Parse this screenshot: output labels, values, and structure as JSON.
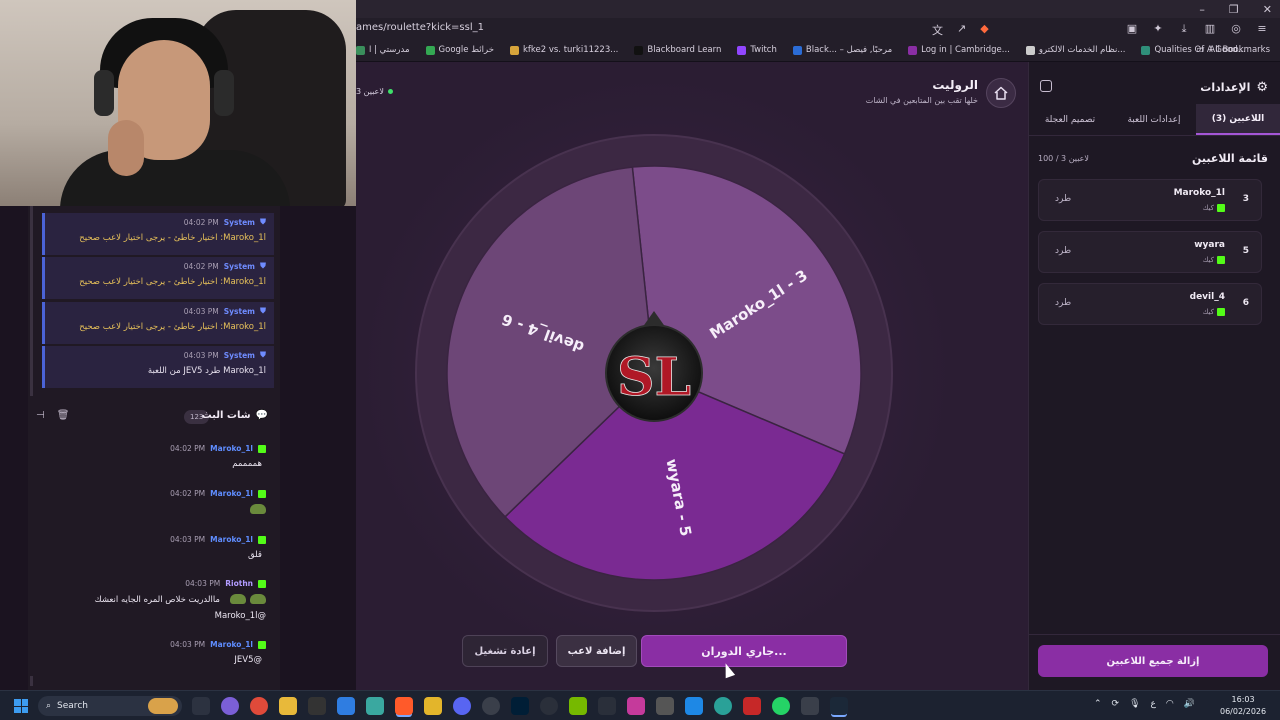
{
  "browser": {
    "url": "ames/roulette?kick=ssl_1",
    "bookmarks": [
      {
        "label": "مدرستي | ا",
        "color": "#3a8f5c"
      },
      {
        "label": "Google خرائط",
        "color": "#34a853"
      },
      {
        "label": "kfke2 vs. turki11223...",
        "color": "#d7a43b"
      },
      {
        "label": "Blackboard Learn",
        "color": "#111111"
      },
      {
        "label": "Twitch",
        "color": "#9146ff"
      },
      {
        "label": "Black... – مرحبًا, فيصل",
        "color": "#2b6cd6"
      },
      {
        "label": "Log in | Cambridge...",
        "color": "#8a2ea4"
      },
      {
        "label": "نظام الخدمات الالكترو...",
        "color": "#cccccc"
      },
      {
        "label": "Qualities Of A Good...",
        "color": "#2f8f7a"
      }
    ],
    "all_bookmarks": "All Bookmarks"
  },
  "system_messages": [
    {
      "name": "System",
      "time": "04:02 PM",
      "text": "Maroko_1l: اختيار خاطئ - يرجى اختيار لاعب صحيح",
      "highlight": true
    },
    {
      "name": "System",
      "time": "04:02 PM",
      "text": "Maroko_1l: اختيار خاطئ - يرجى اختيار لاعب صحيح",
      "highlight": true
    },
    {
      "name": "System",
      "time": "04:03 PM",
      "text": "Maroko_1l: اختيار خاطئ - يرجى اختيار لاعب صحيح",
      "highlight": true
    },
    {
      "name": "System",
      "time": "04:03 PM",
      "text": "Maroko_1l طرد JEV5 من اللعبة",
      "highlight": false
    }
  ],
  "chat": {
    "title": "شات البث",
    "count": "123",
    "messages": [
      {
        "name": "Maroko_1l",
        "time": "04:02 PM",
        "text": "هممممم",
        "color": "blue"
      },
      {
        "name": "Maroko_1l",
        "time": "04:02 PM",
        "text": "",
        "emote": true,
        "color": "blue"
      },
      {
        "name": "Maroko_1l",
        "time": "04:03 PM",
        "text": "قلق",
        "color": "blue"
      },
      {
        "name": "Riothn",
        "time": "04:03 PM",
        "text": "ماالدريت خلاص المره الجايه انعشك",
        "text2": "@Maroko_1l",
        "color": "purple"
      },
      {
        "name": "Maroko_1l",
        "time": "04:03 PM",
        "text": "@JEV5",
        "color": "blue"
      }
    ]
  },
  "main": {
    "players_indicator": "3 لاعبين",
    "title": "الروليت",
    "subtitle": "خلها تقب بين المتابعين في الشات",
    "logo_text": "SL",
    "segments": [
      {
        "label": "Maroko_1l - 3",
        "color": "#7c4c8a"
      },
      {
        "label": "wyara - 5",
        "color": "#7a2a92"
      },
      {
        "label": "devil_4 - 6",
        "color": "#6d4677"
      }
    ],
    "buttons": {
      "restart": "إعادة تشغيل",
      "add_player": "إضافة لاعب",
      "spinning": "جاري الدوران..."
    }
  },
  "settings": {
    "title": "الإعدادات",
    "tabs": [
      {
        "label": "اللاعبين (3)",
        "active": true
      },
      {
        "label": "إعدادات اللعبة",
        "active": false
      },
      {
        "label": "تصميم العجلة",
        "active": false
      }
    ],
    "list_title": "قائمة اللاعبين",
    "list_count": "100 / 3 لاعبين",
    "players": [
      {
        "number": "3",
        "name": "Maroko_1l",
        "platform": "كيك",
        "kick_label": "طرد"
      },
      {
        "number": "5",
        "name": "wyara",
        "platform": "كيك",
        "kick_label": "طرد"
      },
      {
        "number": "6",
        "name": "devil_4",
        "platform": "كيك",
        "kick_label": "طرد"
      }
    ],
    "remove_all": "إزالة جميع اللاعبين"
  },
  "taskbar": {
    "search_placeholder": "Search",
    "tray_lang": "ع",
    "time": "16:03",
    "date": "06/02/2026"
  }
}
